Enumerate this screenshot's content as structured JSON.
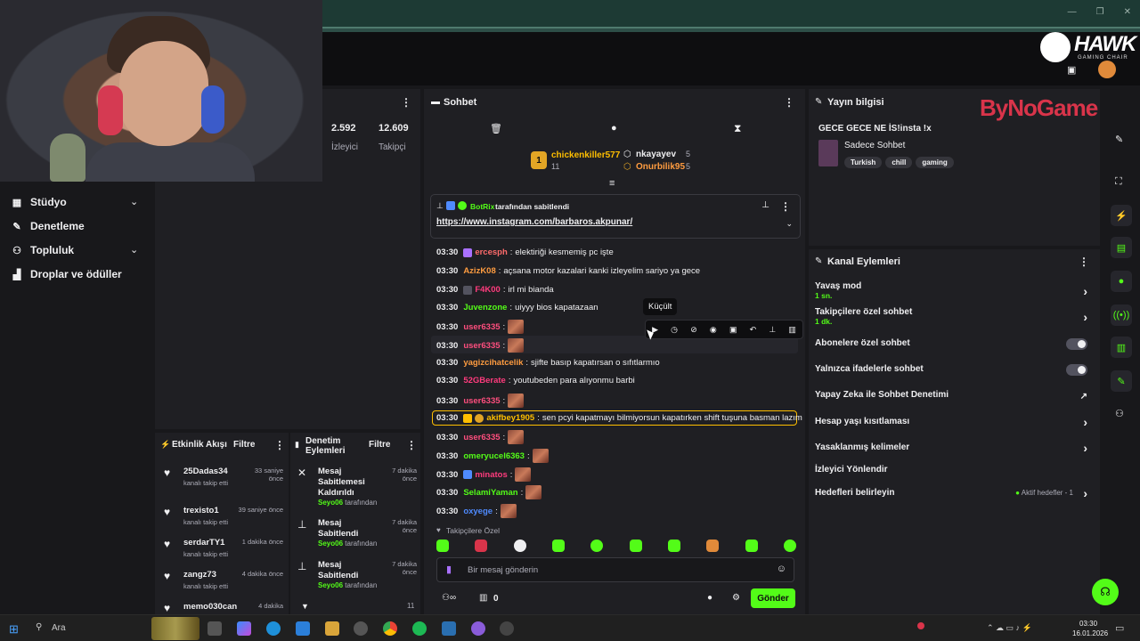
{
  "browser": {
    "window_controls": [
      "—",
      "❐",
      "✕"
    ]
  },
  "left_nav": {
    "items": [
      {
        "label": "Stüdyo",
        "icon": "studio-icon",
        "has_chevron": true
      },
      {
        "label": "Denetleme",
        "icon": "wrench-icon",
        "has_chevron": false
      },
      {
        "label": "Topluluk",
        "icon": "community-icon",
        "has_chevron": true
      },
      {
        "label": "Droplar ve ödüller",
        "icon": "drops-icon",
        "has_chevron": false
      }
    ]
  },
  "stats": {
    "viewers_value": "2.592",
    "viewers_label": "İzleyici",
    "followers_value": "12.609",
    "followers_label": "Takipçi"
  },
  "chat": {
    "title": "Sohbet",
    "leaderboard": [
      {
        "rank": "1",
        "name": "chickenkiller577",
        "count": "11"
      },
      {
        "name": "nkayayev",
        "count": "5"
      },
      {
        "name": "Onurbilik95",
        "count": "5"
      }
    ],
    "pinned": {
      "by": "BotRix",
      "by_suffix": "tarafından sabitlendi",
      "link": "https://www.instagram.com/barbaros.akpunar/"
    },
    "tooltip": "Küçült",
    "messages": [
      {
        "time": "03:30",
        "user": "ercesph",
        "color": "#ff6b6b",
        "text": "elektiriği kesmemiş pc işte"
      },
      {
        "time": "03:30",
        "user": "AzizK08",
        "color": "#ff9c40",
        "text": "açsana motor kazalari kanki izleyelim sariyo ya gece"
      },
      {
        "time": "03:30",
        "user": "F4K00",
        "color": "#ff3b7d",
        "text": "irl mi bianda"
      },
      {
        "time": "03:30",
        "user": "Juvenzone",
        "color": "#53fc18",
        "text": "uiyyy bios kapatazaan"
      },
      {
        "time": "03:30",
        "user": "user6335",
        "color": "#ff4e7e",
        "text": ""
      },
      {
        "time": "03:30",
        "user": "user6335",
        "color": "#ff4e7e",
        "text": ""
      },
      {
        "time": "03:30",
        "user": "yagizcihatcelik",
        "color": "#ff9c40",
        "text": "sjifte basıp kapatırsan o sıfıtlarmıo"
      },
      {
        "time": "03:30",
        "user": "52GBerate",
        "color": "#ff3b7d",
        "text": "youtubeden para alıyonmu barbi"
      },
      {
        "time": "03:30",
        "user": "user6335",
        "color": "#ff4e7e",
        "text": ""
      },
      {
        "time": "03:30",
        "user": "akifbey1905",
        "color": "#ffbf00",
        "text": "sen pcyi kapatmayı bilmiyorsun kapatırken shift tuşuna basman lazım"
      },
      {
        "time": "03:30",
        "user": "user6335",
        "color": "#ff4e7e",
        "text": ""
      },
      {
        "time": "03:30",
        "user": "omeryucel6363",
        "color": "#53fc18",
        "text": ""
      },
      {
        "time": "03:30",
        "user": "minatos",
        "color": "#ff3b7d",
        "text": ""
      },
      {
        "time": "03:30",
        "user": "SelamiYaman",
        "color": "#53fc18",
        "text": ""
      },
      {
        "time": "03:30",
        "user": "oxyege",
        "color": "#4f8bff",
        "text": ""
      }
    ],
    "followers_only_label": "Takipçilere Özel",
    "input_placeholder": "Bir mesaj gönderin",
    "footer_count": "0",
    "send_label": "Gönder"
  },
  "stream_info": {
    "title": "Yayın bilgisi",
    "stream_title": "GECE GECE NE İS!insta !x",
    "category": "Sadece Sohbet",
    "tags": [
      "Turkish",
      "chill",
      "gaming"
    ],
    "sponsor": "ByNoGame"
  },
  "channel_actions": {
    "title": "Kanal Eylemleri",
    "items": [
      {
        "label": "Yavaş mod",
        "sub": "1 sn.",
        "control": "arrow"
      },
      {
        "label": "Takipçilere özel sohbet",
        "sub": "1 dk.",
        "control": "arrow"
      },
      {
        "label": "Abonelere özel sohbet",
        "sub": "",
        "control": "toggle"
      },
      {
        "label": "Yalnızca ifadelerle sohbet",
        "sub": "",
        "control": "toggle"
      },
      {
        "label": "Yapay Zeka ile Sohbet Denetimi",
        "sub": "",
        "control": "external"
      },
      {
        "label": "Hesap yaşı kısıtlaması",
        "sub": "",
        "control": "arrow"
      },
      {
        "label": "Yasaklanmış kelimeler",
        "sub": "",
        "control": "arrow"
      },
      {
        "label": "İzleyici Yönlendir",
        "sub": "",
        "control": "none"
      },
      {
        "label": "Hedefleri belirleyin",
        "sub": "",
        "control": "arrow",
        "extra": "Aktif hedefler - 1"
      }
    ]
  },
  "activity": {
    "title": "Etkinlik Akışı",
    "filter": "Filtre",
    "items": [
      {
        "name": "25Dadas34",
        "action": "kanalı takip etti",
        "time": "33 saniye önce"
      },
      {
        "name": "trexisto1",
        "action": "kanalı takip etti",
        "time": "39 saniye önce"
      },
      {
        "name": "serdarTY1",
        "action": "kanalı takip etti",
        "time": "1 dakika önce"
      },
      {
        "name": "zangz73",
        "action": "kanalı takip etti",
        "time": "4 dakika önce"
      },
      {
        "name": "memo030can",
        "action": "",
        "time": "4 dakika"
      }
    ]
  },
  "moderation": {
    "title": "Denetim Eylemleri",
    "filter": "Filtre",
    "items": [
      {
        "action": "Mesaj Sabitlemesi Kaldırıldı",
        "by": "Seyo06",
        "by_suffix": "tarafından",
        "time": "7 dakika önce"
      },
      {
        "action": "Mesaj Sabitlendi",
        "by": "Seyo06",
        "by_suffix": "tarafından",
        "time": "7 dakika önce"
      },
      {
        "action": "Mesaj Sabitlendi",
        "by": "Seyo06",
        "by_suffix": "tarafından",
        "time": "7 dakika önce"
      }
    ],
    "more": "11"
  },
  "overlay": {
    "brand": "HAWK",
    "brand_sub": "GAMING CHAIR"
  },
  "taskbar": {
    "search_placeholder": "Ara",
    "time": "03:30",
    "date": "16.01.2026"
  }
}
